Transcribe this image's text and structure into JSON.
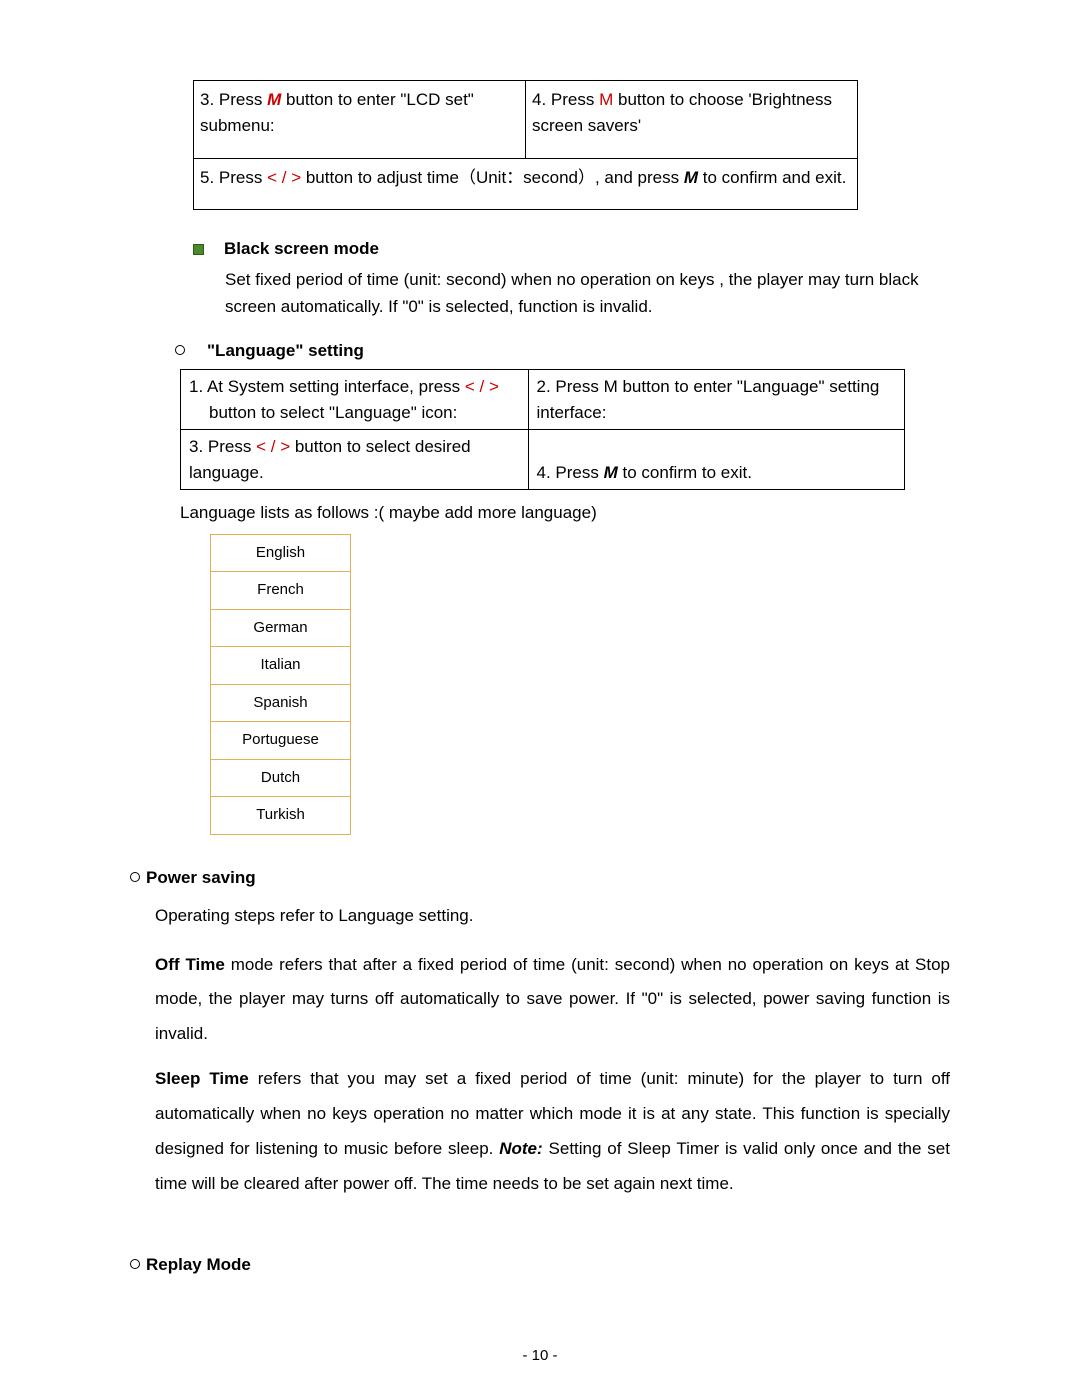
{
  "lcd_table": {
    "step3_prefix": "3. Press ",
    "step3_m": "M",
    "step3_suffix": " button to enter \"LCD set\" submenu:",
    "step4_prefix": "4. Press ",
    "step4_m": "M",
    "step4_suffix": " button to choose 'Brightness screen savers'",
    "step5_a": "5. Press ",
    "step5_arrows": "< / >",
    "step5_b": " button to adjust time（Unit：second）, and press ",
    "step5_m": "M",
    "step5_c": " to confirm and exit."
  },
  "black_screen": {
    "title": "Black screen mode",
    "body": "Set fixed period of time (unit: second) when no operation on keys , the player may turn black screen   automatically. If \"0\" is selected, function is invalid."
  },
  "language": {
    "heading": "\"Language\" setting",
    "row1_left_a": "1. At System setting interface, press ",
    "row1_left_arrows": "< / >",
    "row1_left_b": "button to select \"Language\" icon:",
    "row1_right": "2. Press M button to enter \"Language\" setting interface:",
    "row2_left_a": "3. Press ",
    "row2_left_arrows": "< / >",
    "row2_left_b": " button to select desired language.",
    "row2_right_a": "4. Press ",
    "row2_right_m": "M",
    "row2_right_b": " to confirm to exit.",
    "list_caption": "Language lists as follows :( maybe add more language)",
    "items": [
      "English",
      "French",
      "German",
      "Italian",
      "Spanish",
      "Portuguese",
      "Dutch",
      "Turkish"
    ]
  },
  "power_saving": {
    "heading": "Power saving",
    "line1": "Operating steps refer to Language setting.",
    "offtime_lead": "Off Time",
    "offtime_body": " mode refers that after a fixed period of time (unit: second) when no operation on keys at Stop mode, the player may turns off automatically to save power. If \"0\" is selected, power saving function is invalid.",
    "sleep_lead": "Sleep Time",
    "sleep_body_a": " refers that you may set a fixed period of time (unit: minute) for the player to turn off automatically when no keys operation no matter which mode it is at any state. This function is specially designed for listening to music before sleep. ",
    "sleep_note": "Note:",
    "sleep_body_b": " Setting of Sleep Timer is valid only once and the set time will be cleared after power off. The time needs to be set again next time."
  },
  "replay": {
    "heading": "Replay Mode"
  },
  "page_number": "- 10 -"
}
